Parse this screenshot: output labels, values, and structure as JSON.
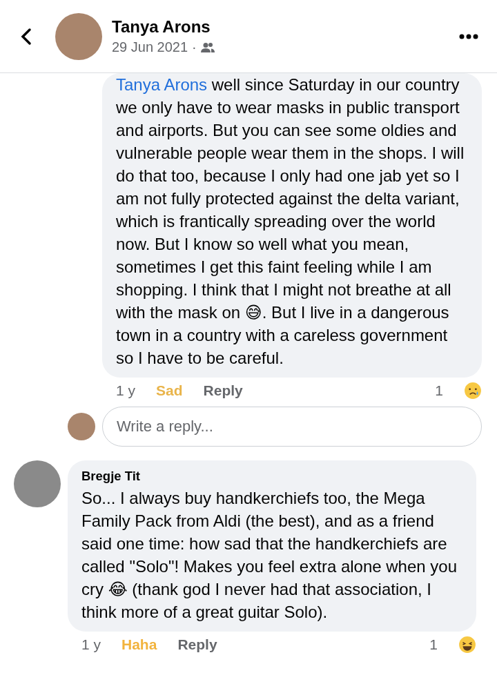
{
  "header": {
    "title": "Tanya Arons",
    "date": "29 Jun 2021",
    "separator": "·"
  },
  "comments": [
    {
      "kind": "continued",
      "mention": "Tanya Arons",
      "text": "well since Saturday in our country we only have to wear masks in public transport and airports. But you can see some oldies and vulnerable people wear them in the shops. I will do that too, because I only had one jab yet so I am not fully protected against the delta variant, which is frantically spreading over the world now. But I know so well what you mean, sometimes I get this faint feeling while I am shopping. I think that I might not breathe at all with the mask on 😅. But I live in a dangerous town in a country with a careless government so I have to be careful.",
      "age": "1 y",
      "reaction": {
        "label": "Sad",
        "kind": "sad"
      },
      "reply_label": "Reply",
      "reaction_count": "1"
    },
    {
      "kind": "full",
      "author": "Bregje Tit",
      "text": "So... I always buy handkerchiefs too, the Mega Family Pack from Aldi (the best), and as a friend said one time: how sad that the handkerchiefs are called \"Solo\"! Makes you feel extra alone when you cry 😂 (thank god I never had that association, I think more of a great guitar Solo).",
      "age": "1 y",
      "reaction": {
        "label": "Haha",
        "kind": "haha"
      },
      "reply_label": "Reply",
      "reaction_count": "1"
    }
  ],
  "reply_field": {
    "placeholder": "Write a reply..."
  }
}
